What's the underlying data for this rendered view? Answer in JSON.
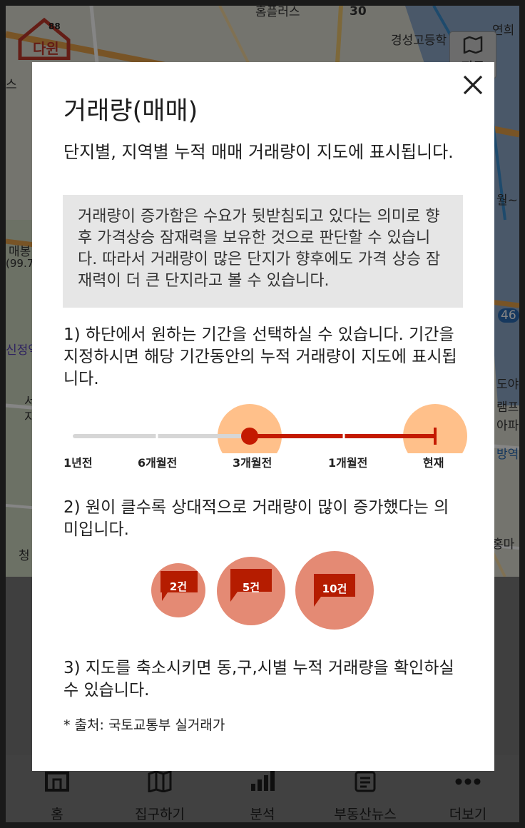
{
  "background": {
    "map_labels": [
      "홈플러스",
      "30",
      "경성고등학",
      "연희",
      "스",
      "월~",
      "매봉",
      "(99.7",
      "46",
      "신정역",
      "서",
      "지",
      "램프",
      "아파",
      "방역",
      "청",
      "홍마",
      "도야"
    ],
    "map_button_label": "지도",
    "brand_badge_number": "88",
    "brand_label": "다윈"
  },
  "tabbar": {
    "items": [
      {
        "label": "홈",
        "icon": "home-icon"
      },
      {
        "label": "집구하기",
        "icon": "map-book-icon"
      },
      {
        "label": "분석",
        "icon": "bar-chart-icon"
      },
      {
        "label": "부동산뉴스",
        "icon": "news-icon"
      },
      {
        "label": "더보기",
        "icon": "more-dots-icon"
      }
    ]
  },
  "modal": {
    "title": "거래량(매매)",
    "intro": "단지별, 지역별 누적 매매 거래량이 지도에 표시됩니다.",
    "note": "거래량이 증가함은 수요가 뒷받침되고 있다는 의미로 향후 가격상승 잠재력을 보유한 것으로 판단할 수 있습니다. 따라서 거래량이 많은 단지가 향후에도 가격 상승 잠재력이 더 큰 단지라고 볼 수 있습니다.",
    "step1": "1) 하단에서 원하는 기간을 선택하실 수 있습니다. 기간을 지정하시면 해당 기간동안의 누적 거래량이 지도에 표시됩니다.",
    "timeline": {
      "labels": [
        "1년전",
        "6개월전",
        "3개월전",
        "1개월전",
        "현재"
      ],
      "selected_start": "3개월전",
      "selected_end": "현재"
    },
    "step2": "2) 원이 클수록 상대적으로 거래량이 많이 증가했다는 의미입니다.",
    "bubbles": [
      "2건",
      "5건",
      "10건"
    ],
    "step3": "3) 지도를 축소시키면 동,구,시별 누적 거래량을 확인하실 수 있습니다.",
    "source": "* 출처: 국토교통부 실거래가"
  },
  "colors": {
    "accent_red": "#c41a00",
    "highlight_peach": "#ffc08a",
    "bubble_fill": "#e48a74",
    "bubble_badge": "#b51c00",
    "note_bg": "#e6e6e6"
  }
}
